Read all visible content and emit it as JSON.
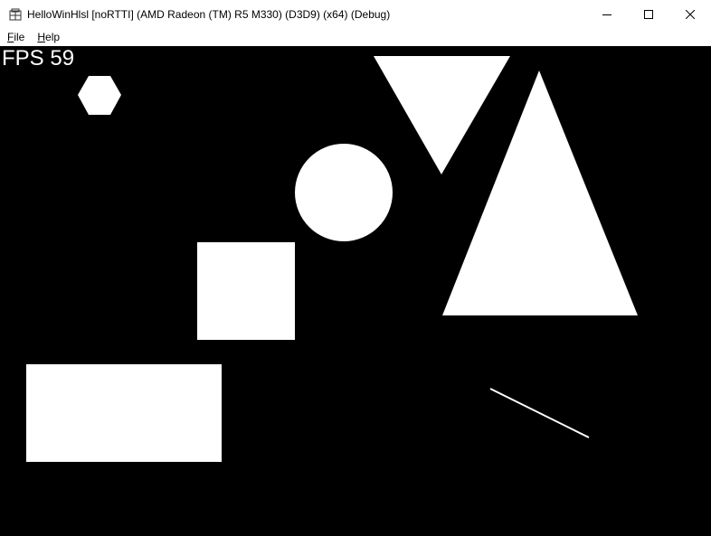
{
  "window": {
    "title": "HelloWinHlsl [noRTTI] (AMD Radeon (TM) R5 M330) (D3D9) (x64) (Debug)",
    "controls": [
      "minimize-icon",
      "maximize-icon",
      "close-icon"
    ]
  },
  "menu": {
    "items": [
      {
        "label": "File",
        "accel": "F",
        "rest": "ile"
      },
      {
        "label": "Help",
        "accel": "H",
        "rest": "elp"
      }
    ]
  },
  "scene": {
    "fps_label": "FPS 59",
    "background": "#000000",
    "shape_color": "#ffffff",
    "shapes": [
      "hexagon",
      "inverted-triangle",
      "circle",
      "triangle",
      "square",
      "rectangle",
      "line"
    ]
  }
}
